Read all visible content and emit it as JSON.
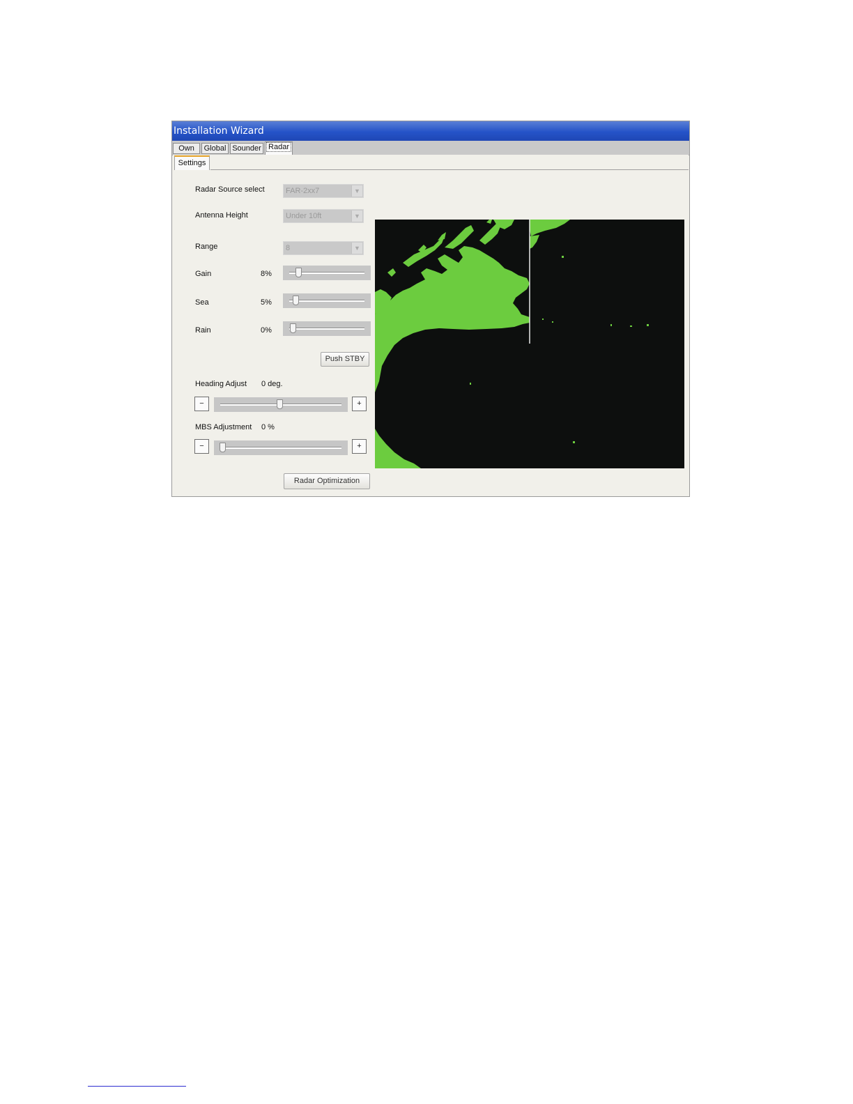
{
  "window": {
    "title": "Installation Wizard",
    "tabs": [
      "Own",
      "Global",
      "Sounder",
      "Radar"
    ],
    "active_tab": "Radar",
    "subtab": "Settings"
  },
  "settings": {
    "radar_source": {
      "label": "Radar Source select",
      "value": "FAR-2xx7"
    },
    "antenna_height": {
      "label": "Antenna Height",
      "value": "Under 10ft"
    },
    "range": {
      "label": "Range",
      "value": "8"
    },
    "gain": {
      "label": "Gain",
      "value_text": "8%",
      "value": 8
    },
    "sea": {
      "label": "Sea",
      "value_text": "5%",
      "value": 5
    },
    "rain": {
      "label": "Rain",
      "value_text": "0%",
      "value": 0
    },
    "push_stby": "Push STBY",
    "heading_adjust": {
      "label": "Heading Adjust",
      "value_text": "0 deg.",
      "position": 0.5
    },
    "mbs_adjustment": {
      "label": "MBS Adjustment",
      "value_text": "0 %",
      "position": 0.0
    },
    "minus": "−",
    "plus": "+",
    "radar_optimization": "Radar Optimization"
  },
  "colors": {
    "radar_bg": "#0d0f0e",
    "radar_echo": "#6ccc3f",
    "titlebar": "#2553c8"
  }
}
